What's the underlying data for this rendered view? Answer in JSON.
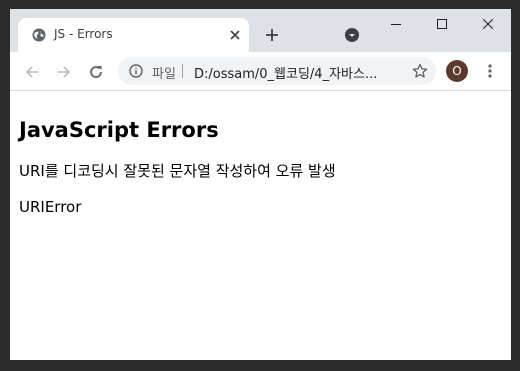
{
  "browser": {
    "tab": {
      "title": "JS - Errors"
    },
    "omnibox": {
      "scheme_label": "파일",
      "url": "D:/ossam/0_웹코딩/4_자바스..."
    },
    "profile": {
      "initial": "O"
    }
  },
  "page": {
    "heading": "JavaScript Errors",
    "description": "URI를 디코딩시 잘못된 문자열 작성하여 오류 발생",
    "error_output": "URIError"
  },
  "colors": {
    "tabstrip": "#dee1e6",
    "omnibox": "#f1f3f4",
    "avatar": "#5d3a2e",
    "outer_background": "#2b2b2b"
  },
  "icons": {
    "favicon": "globe-icon",
    "tab_close": "close-icon",
    "new_tab": "plus-icon",
    "profile_menu": "down-arrow-circle-icon",
    "minimize": "minimize-icon",
    "maximize": "maximize-icon",
    "close_window": "close-icon",
    "back": "back-arrow-icon",
    "forward": "forward-arrow-icon",
    "reload": "reload-icon",
    "site_info": "info-icon",
    "bookmark": "star-icon",
    "menu": "kebab-menu-icon"
  }
}
